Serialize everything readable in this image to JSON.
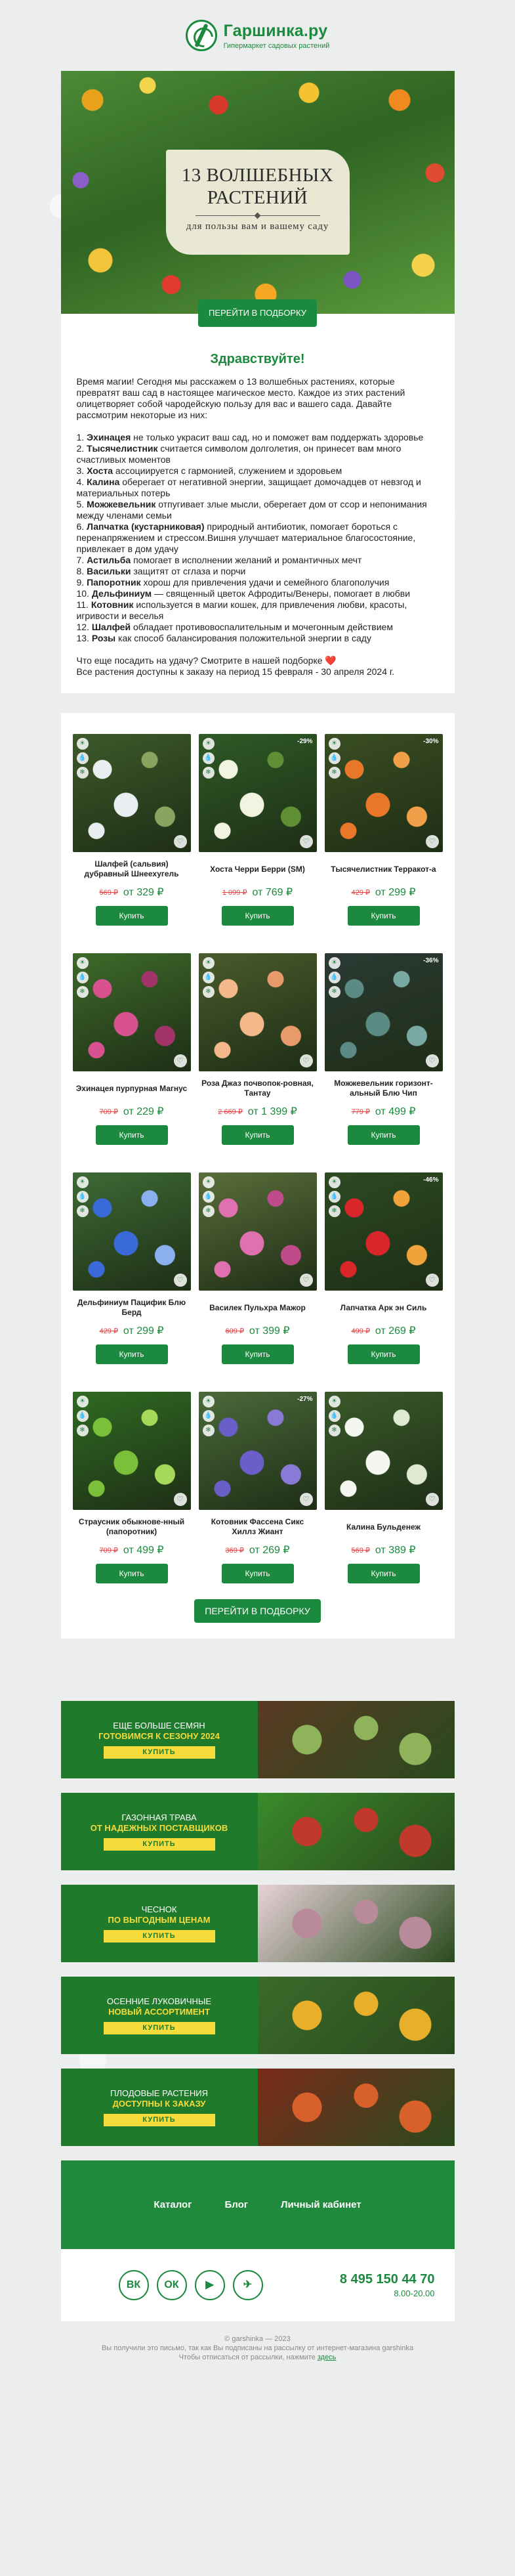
{
  "header": {
    "brand": "Гаршинка.ру",
    "tagline": "Гипермаркет садовых растений"
  },
  "hero": {
    "title": "13 ВОЛШЕБНЫХ\nРАСТЕНИЙ",
    "subtitle": "для пользы вам и вашему саду",
    "button": "ПЕРЕЙТИ В ПОДБОРКУ"
  },
  "letter": {
    "greeting": "Здравствуйте!",
    "intro": "Время магии! Сегодня мы расскажем о 13 волшебных растениях, которые превратят ваш сад в настоящее магическое место. Каждое из этих растений олицетворяет собой чародейскую пользу для вас и вашего сада. Давайте рассмотрим некоторые из них:",
    "items": [
      {
        "num": "1.",
        "name": "Эхинацея",
        "text": " не только украсит ваш сад, но и поможет вам поддержать здоровье"
      },
      {
        "num": "2.",
        "name": "Тысячелистник",
        "text": " считается символом долголетия, он принесет вам много счастливых моментов"
      },
      {
        "num": "3.",
        "name": "Хоста",
        "text": " ассоциируется с гармонией, служением и здоровьем"
      },
      {
        "num": "4.",
        "name": "Калина",
        "text": " оберегает от негативной энергии, защищает домочадцев от невзгод и материальных потерь"
      },
      {
        "num": "5.",
        "name": "Можжевельник",
        "text": " отпугивает злые мысли, оберегает дом от ссор и непонимания между членами семьи"
      },
      {
        "num": "6.",
        "name": "Лапчатка (кустарниковая)",
        "text": " природный антибиотик, помогает бороться с перенапряжением и стрессом.Вишня улучшает материальное благосостояние, привлекает в дом удачу"
      },
      {
        "num": "7.",
        "name": "Астильба",
        "text": " помогает в исполнении желаний и романтичных мечт"
      },
      {
        "num": "8.",
        "name": "Васильки",
        "text": " защитят от сглаза и порчи"
      },
      {
        "num": "9.",
        "name": "Папоротник",
        "text": " хорош для привлечения удачи и семейного благополучия"
      },
      {
        "num": "10.",
        "name": "Дельфиниум",
        "text": " — священный цветок Афродиты/Венеры, помогает в любви"
      },
      {
        "num": "11.",
        "name": "Котовник",
        "text": " используется в магии кошек, для привлечения любви, красоты, игривости и веселья"
      },
      {
        "num": "12.",
        "name": "Шалфей",
        "text": " обладает противовоспалительным и мочегонным действием"
      },
      {
        "num": "13.",
        "name": "Розы",
        "text": " как способ балансирования положительной энергии в саду"
      }
    ],
    "outro1": "Что еще посадить на удачу? Смотрите в нашей подборке ❤️",
    "outro2": "Все растения доступны к заказу на период 15 февраля - 30 апреля 2024 г."
  },
  "products": [
    {
      "name": "Шалфей (сальвия) дубравный Шнеехугель",
      "old": "569 ₽",
      "price": "от 329 ₽",
      "badge": "",
      "c1": "#3d5a2a",
      "c2": "#e9eef0",
      "c3": "#8aa35e"
    },
    {
      "name": "Хоста Черри Берри (SM)",
      "old": "1 099 ₽",
      "price": "от 769 ₽",
      "badge": "-29%",
      "c1": "#2e5a26",
      "c2": "#f1f4e0",
      "c3": "#5f8f35"
    },
    {
      "name": "Тысячелистник Терракот-а",
      "old": "429 ₽",
      "price": "от 299 ₽",
      "badge": "-30%",
      "c1": "#3a4e22",
      "c2": "#e8772a",
      "c3": "#f0a048"
    },
    {
      "name": "Эхинацея пурпурная Магнус",
      "old": "709 ₽",
      "price": "от 229 ₽",
      "badge": "",
      "c1": "#3e6a2a",
      "c2": "#d8528f",
      "c3": "#a2346a"
    },
    {
      "name": "Роза Джаз почвопок-ровная, Тантау",
      "old": "2 669 ₽",
      "price": "от 1 399 ₽",
      "badge": "",
      "c1": "#4a5b2c",
      "c2": "#f3b98a",
      "c3": "#e89a6a"
    },
    {
      "name": "Можжевельник горизонт-альный Блю Чип",
      "old": "779 ₽",
      "price": "от 499 ₽",
      "badge": "-36%",
      "c1": "#2b3a34",
      "c2": "#5c8b86",
      "c3": "#7aa8a2"
    },
    {
      "name": "Дельфиниум Пацифик Блю Берд",
      "old": "429 ₽",
      "price": "от 299 ₽",
      "badge": "",
      "c1": "#3d6a35",
      "c2": "#3a6ad8",
      "c3": "#8ab0f0"
    },
    {
      "name": "Василек Пульхра Мажор",
      "old": "609 ₽",
      "price": "от 399 ₽",
      "badge": "",
      "c1": "#5a6e3a",
      "c2": "#e070b0",
      "c3": "#c04b8a"
    },
    {
      "name": "Лапчатка Арк эн Силь",
      "old": "499 ₽",
      "price": "от 269 ₽",
      "badge": "-46%",
      "c1": "#2c4a22",
      "c2": "#d8262a",
      "c3": "#f0a33a"
    },
    {
      "name": "Страусник обыкнове-нный (папоротник)",
      "old": "709 ₽",
      "price": "от 499 ₽",
      "badge": "",
      "c1": "#2f6a22",
      "c2": "#7cc03a",
      "c3": "#a6d85a"
    },
    {
      "name": "Котовник Фассена Сикс Хиллз Жиант",
      "old": "369 ₽",
      "price": "от 269 ₽",
      "badge": "-27%",
      "c1": "#4a6a3a",
      "c2": "#6a5ec8",
      "c3": "#8a7ad8"
    },
    {
      "name": "Калина Бульденеж",
      "old": "569 ₽",
      "price": "от 389 ₽",
      "badge": "",
      "c1": "#3a5a2a",
      "c2": "#f4f6f0",
      "c3": "#dfe8d0"
    }
  ],
  "buy_label": "Купить",
  "cta2": "ПЕРЕЙТИ В ПОДБОРКУ",
  "banners": [
    {
      "line1": "ЕЩЕ БОЛЬШЕ СЕМЯН",
      "line2": "ГОТОВИМСЯ К СЕЗОНУ 2024",
      "button": "КУПИТЬ",
      "c1": "#5a3a22",
      "c2": "#8fb35a"
    },
    {
      "line1": "ГАЗОННАЯ ТРАВА",
      "line2": "ОТ НАДЕЖНЫХ ПОСТАВЩИКОВ",
      "button": "КУПИТЬ",
      "c1": "#3a8a2a",
      "c2": "#c0392b"
    },
    {
      "line1": "ЧЕСНОК",
      "line2": "ПО ВЫГОДНЫМ ЦЕНАМ",
      "button": "КУПИТЬ",
      "c1": "#e8d2d8",
      "c2": "#b88a9a"
    },
    {
      "line1": "ОСЕННИЕ ЛУКОВИЧНЫЕ",
      "line2": "НОВЫЙ АССОРТИМЕНТ",
      "button": "КУПИТЬ",
      "c1": "#3a6a2a",
      "c2": "#e8b02a"
    },
    {
      "line1": "ПЛОДОВЫЕ РАСТЕНИЯ",
      "line2": "ДОСТУПНЫ К ЗАКАЗУ",
      "button": "КУПИТЬ",
      "c1": "#7a2a1a",
      "c2": "#d8602a"
    }
  ],
  "footer": {
    "nav": [
      "Каталог",
      "Блог",
      "Личный кабинет"
    ],
    "socials": [
      "ВК",
      "ОК",
      "▶",
      "✈"
    ],
    "phone": "8 495 150 44 70",
    "hours": "8.00-20.00",
    "copyright": "© garshinka — 2023",
    "notice": "Вы получили это письмо, так как Вы подписаны на рассылку от интернет-магазина garshinka",
    "unsub_text": "Чтобы отписаться от рассылки, нажмите",
    "unsub_link": "здесь"
  },
  "colors": {
    "brand_green": "#1c8a3e",
    "price_old": "#e04444",
    "banner_yellow": "#f5dc3a"
  }
}
